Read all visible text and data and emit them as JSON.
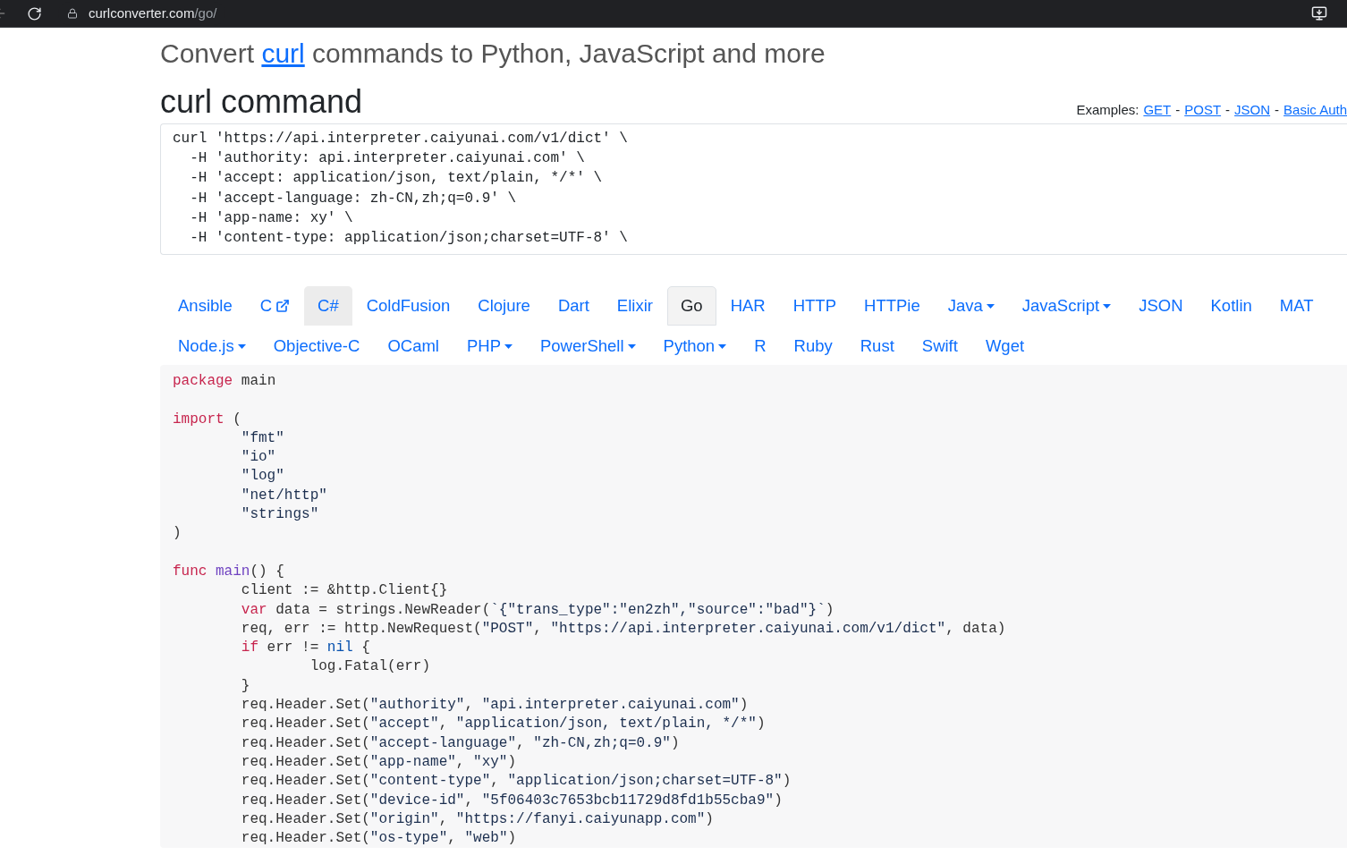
{
  "browser": {
    "url_host": "curlconverter.com",
    "url_path": "/go/"
  },
  "headline": {
    "before": "Convert ",
    "link": "curl",
    "after": " commands to Python, JavaScript and more"
  },
  "curl_section": {
    "title": "curl command",
    "examples_label": "Examples:",
    "examples": [
      "GET",
      "POST",
      "JSON",
      "Basic Auth"
    ],
    "separator": "-",
    "lines": [
      "curl 'https://api.interpreter.caiyunai.com/v1/dict' \\",
      "  -H 'authority: api.interpreter.caiyunai.com' \\",
      "  -H 'accept: application/json, text/plain, */*' \\",
      "  -H 'accept-language: zh-CN,zh;q=0.9' \\",
      "  -H 'app-name: xy' \\",
      "  -H 'content-type: application/json;charset=UTF-8' \\"
    ]
  },
  "language_tabs": [
    [
      {
        "label": "Ansible",
        "selected": false,
        "hovered": false,
        "dropdown": false,
        "external": false
      },
      {
        "label": "C",
        "selected": false,
        "hovered": false,
        "dropdown": false,
        "external": true
      },
      {
        "label": "C#",
        "selected": false,
        "hovered": true,
        "dropdown": false,
        "external": false
      },
      {
        "label": "ColdFusion",
        "selected": false,
        "hovered": false,
        "dropdown": false,
        "external": false
      },
      {
        "label": "Clojure",
        "selected": false,
        "hovered": false,
        "dropdown": false,
        "external": false
      },
      {
        "label": "Dart",
        "selected": false,
        "hovered": false,
        "dropdown": false,
        "external": false
      },
      {
        "label": "Elixir",
        "selected": false,
        "hovered": false,
        "dropdown": false,
        "external": false
      },
      {
        "label": "Go",
        "selected": true,
        "hovered": false,
        "dropdown": false,
        "external": false
      },
      {
        "label": "HAR",
        "selected": false,
        "hovered": false,
        "dropdown": false,
        "external": false
      },
      {
        "label": "HTTP",
        "selected": false,
        "hovered": false,
        "dropdown": false,
        "external": false
      },
      {
        "label": "HTTPie",
        "selected": false,
        "hovered": false,
        "dropdown": false,
        "external": false
      },
      {
        "label": "Java",
        "selected": false,
        "hovered": false,
        "dropdown": true,
        "external": false
      },
      {
        "label": "JavaScript",
        "selected": false,
        "hovered": false,
        "dropdown": true,
        "external": false
      },
      {
        "label": "JSON",
        "selected": false,
        "hovered": false,
        "dropdown": false,
        "external": false
      },
      {
        "label": "Kotlin",
        "selected": false,
        "hovered": false,
        "dropdown": false,
        "external": false
      },
      {
        "label": "MAT",
        "selected": false,
        "hovered": false,
        "dropdown": false,
        "external": false
      }
    ],
    [
      {
        "label": "Node.js",
        "selected": false,
        "hovered": false,
        "dropdown": true,
        "external": false
      },
      {
        "label": "Objective-C",
        "selected": false,
        "hovered": false,
        "dropdown": false,
        "external": false
      },
      {
        "label": "OCaml",
        "selected": false,
        "hovered": false,
        "dropdown": false,
        "external": false
      },
      {
        "label": "PHP",
        "selected": false,
        "hovered": false,
        "dropdown": true,
        "external": false
      },
      {
        "label": "PowerShell",
        "selected": false,
        "hovered": false,
        "dropdown": true,
        "external": false
      },
      {
        "label": "Python",
        "selected": false,
        "hovered": false,
        "dropdown": true,
        "external": false
      },
      {
        "label": "R",
        "selected": false,
        "hovered": false,
        "dropdown": false,
        "external": false
      },
      {
        "label": "Ruby",
        "selected": false,
        "hovered": false,
        "dropdown": false,
        "external": false
      },
      {
        "label": "Rust",
        "selected": false,
        "hovered": false,
        "dropdown": false,
        "external": false
      },
      {
        "label": "Swift",
        "selected": false,
        "hovered": false,
        "dropdown": false,
        "external": false
      },
      {
        "label": "Wget",
        "selected": false,
        "hovered": false,
        "dropdown": false,
        "external": false
      }
    ]
  ],
  "code_lines": [
    {
      "kind": "code",
      "segments": [
        {
          "kind": "keyword",
          "text": "package"
        },
        {
          "kind": "plain",
          "text": " main"
        }
      ]
    },
    {
      "kind": "blank"
    },
    {
      "kind": "code",
      "segments": [
        {
          "kind": "keyword",
          "text": "import"
        },
        {
          "kind": "plain",
          "text": " ("
        }
      ]
    },
    {
      "kind": "code",
      "segments": [
        {
          "kind": "string",
          "text": "        \"fmt\""
        }
      ]
    },
    {
      "kind": "code",
      "segments": [
        {
          "kind": "string",
          "text": "        \"io\""
        }
      ]
    },
    {
      "kind": "code",
      "segments": [
        {
          "kind": "string",
          "text": "        \"log\""
        }
      ]
    },
    {
      "kind": "code",
      "segments": [
        {
          "kind": "string",
          "text": "        \"net/http\""
        }
      ]
    },
    {
      "kind": "code",
      "segments": [
        {
          "kind": "string",
          "text": "        \"strings\""
        }
      ]
    },
    {
      "kind": "code",
      "segments": [
        {
          "kind": "plain",
          "text": ")"
        }
      ]
    },
    {
      "kind": "blank"
    },
    {
      "kind": "code",
      "segments": [
        {
          "kind": "keyword",
          "text": "func"
        },
        {
          "kind": "function",
          "text": " main"
        },
        {
          "kind": "plain",
          "text": "() {"
        }
      ]
    },
    {
      "kind": "code",
      "segments": [
        {
          "kind": "plain",
          "text": "        client := &http.Client{}"
        }
      ]
    },
    {
      "kind": "code",
      "segments": [
        {
          "kind": "keyword",
          "text": "        var"
        },
        {
          "kind": "plain",
          "text": " data = strings.NewReader("
        },
        {
          "kind": "string",
          "text": "`{\"trans_type\":\"en2zh\",\"source\":\"bad\"}`"
        },
        {
          "kind": "plain",
          "text": ")"
        }
      ]
    },
    {
      "kind": "code",
      "segments": [
        {
          "kind": "plain",
          "text": "        req, err := http.NewRequest("
        },
        {
          "kind": "string",
          "text": "\"POST\""
        },
        {
          "kind": "plain",
          "text": ", "
        },
        {
          "kind": "string",
          "text": "\"https://api.interpreter.caiyunai.com/v1/dict\""
        },
        {
          "kind": "plain",
          "text": ", data)"
        }
      ]
    },
    {
      "kind": "code",
      "segments": [
        {
          "kind": "keyword",
          "text": "        if"
        },
        {
          "kind": "plain",
          "text": " err != "
        },
        {
          "kind": "constant",
          "text": "nil"
        },
        {
          "kind": "plain",
          "text": " {"
        }
      ]
    },
    {
      "kind": "code",
      "segments": [
        {
          "kind": "plain",
          "text": "                log.Fatal(err)"
        }
      ]
    },
    {
      "kind": "code",
      "segments": [
        {
          "kind": "plain",
          "text": "        }"
        }
      ]
    },
    {
      "kind": "code",
      "segments": [
        {
          "kind": "plain",
          "text": "        req.Header.Set("
        },
        {
          "kind": "string",
          "text": "\"authority\""
        },
        {
          "kind": "plain",
          "text": ", "
        },
        {
          "kind": "string",
          "text": "\"api.interpreter.caiyunai.com\""
        },
        {
          "kind": "plain",
          "text": ")"
        }
      ]
    },
    {
      "kind": "code",
      "segments": [
        {
          "kind": "plain",
          "text": "        req.Header.Set("
        },
        {
          "kind": "string",
          "text": "\"accept\""
        },
        {
          "kind": "plain",
          "text": ", "
        },
        {
          "kind": "string",
          "text": "\"application/json, text/plain, */*\""
        },
        {
          "kind": "plain",
          "text": ")"
        }
      ]
    },
    {
      "kind": "code",
      "segments": [
        {
          "kind": "plain",
          "text": "        req.Header.Set("
        },
        {
          "kind": "string",
          "text": "\"accept-language\""
        },
        {
          "kind": "plain",
          "text": ", "
        },
        {
          "kind": "string",
          "text": "\"zh-CN,zh;q=0.9\""
        },
        {
          "kind": "plain",
          "text": ")"
        }
      ]
    },
    {
      "kind": "code",
      "segments": [
        {
          "kind": "plain",
          "text": "        req.Header.Set("
        },
        {
          "kind": "string",
          "text": "\"app-name\""
        },
        {
          "kind": "plain",
          "text": ", "
        },
        {
          "kind": "string",
          "text": "\"xy\""
        },
        {
          "kind": "plain",
          "text": ")"
        }
      ]
    },
    {
      "kind": "code",
      "segments": [
        {
          "kind": "plain",
          "text": "        req.Header.Set("
        },
        {
          "kind": "string",
          "text": "\"content-type\""
        },
        {
          "kind": "plain",
          "text": ", "
        },
        {
          "kind": "string",
          "text": "\"application/json;charset=UTF-8\""
        },
        {
          "kind": "plain",
          "text": ")"
        }
      ]
    },
    {
      "kind": "code",
      "segments": [
        {
          "kind": "plain",
          "text": "        req.Header.Set("
        },
        {
          "kind": "string",
          "text": "\"device-id\""
        },
        {
          "kind": "plain",
          "text": ", "
        },
        {
          "kind": "string",
          "text": "\"5f06403c7653bcb11729d8fd1b55cba9\""
        },
        {
          "kind": "plain",
          "text": ")"
        }
      ]
    },
    {
      "kind": "code",
      "segments": [
        {
          "kind": "plain",
          "text": "        req.Header.Set("
        },
        {
          "kind": "string",
          "text": "\"origin\""
        },
        {
          "kind": "plain",
          "text": ", "
        },
        {
          "kind": "string",
          "text": "\"https://fanyi.caiyunapp.com\""
        },
        {
          "kind": "plain",
          "text": ")"
        }
      ]
    },
    {
      "kind": "code",
      "segments": [
        {
          "kind": "plain",
          "text": "        req.Header.Set("
        },
        {
          "kind": "string",
          "text": "\"os-type\""
        },
        {
          "kind": "plain",
          "text": ", "
        },
        {
          "kind": "string",
          "text": "\"web\""
        },
        {
          "kind": "plain",
          "text": ")"
        }
      ]
    }
  ]
}
